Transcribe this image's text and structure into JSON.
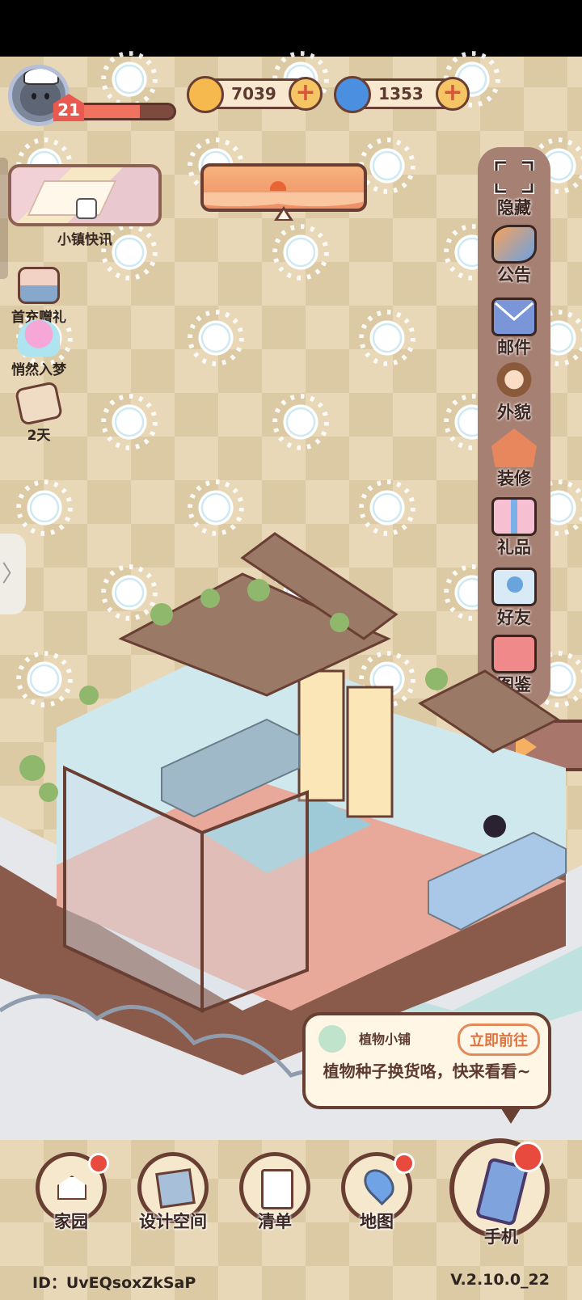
{
  "player": {
    "level": "21",
    "level_progress_pct": 65
  },
  "currencies": [
    {
      "name": "coin-currency",
      "value": "7039",
      "icon": "coin-icon",
      "color": "#f5b94e"
    },
    {
      "name": "gem-currency",
      "value": "1353",
      "icon": "swirl-gem-icon",
      "color": "#4a8fe0"
    }
  ],
  "news": {
    "label": "小镇快讯"
  },
  "left_events": [
    {
      "name": "first-recharge-gift",
      "label": "首充赠礼",
      "icon": "gift-box-icon"
    },
    {
      "name": "dream-event",
      "label": "悄然入梦",
      "icon": "pink-cat-icon"
    },
    {
      "name": "letter-event",
      "label": "2天",
      "icon": "letter-icon"
    }
  ],
  "right_menu": [
    {
      "name": "hide",
      "label": "隐藏",
      "icon": "fullscreen-icon"
    },
    {
      "name": "announcement",
      "label": "公告",
      "icon": "megaphone-icon"
    },
    {
      "name": "mail",
      "label": "邮件",
      "icon": "envelope-icon"
    },
    {
      "name": "appearance",
      "label": "外貌",
      "icon": "character-icon"
    },
    {
      "name": "decorate",
      "label": "装修",
      "icon": "house-wrench-icon"
    },
    {
      "name": "gifts",
      "label": "礼品",
      "icon": "present-icon"
    },
    {
      "name": "friends",
      "label": "好友",
      "icon": "friend-card-icon"
    },
    {
      "name": "collection",
      "label": "图鉴",
      "icon": "album-icon"
    }
  ],
  "notification": {
    "title": "植物小铺",
    "button": "立即前往",
    "message": "植物种子换货咯，快来看看~"
  },
  "bottom_nav": [
    {
      "name": "home",
      "label": "家园",
      "icon": "house-icon",
      "badge": true
    },
    {
      "name": "design",
      "label": "设计空间",
      "icon": "ruler-icon",
      "badge": false
    },
    {
      "name": "list",
      "label": "清单",
      "icon": "checklist-icon",
      "badge": false
    },
    {
      "name": "map",
      "label": "地图",
      "icon": "map-pin-icon",
      "badge": true
    },
    {
      "name": "phone",
      "label": "手机",
      "icon": "phone-icon",
      "badge": true
    }
  ],
  "footer": {
    "id": "ID：UvEQsoxZkSaP",
    "version": "V.2.10.0_22"
  },
  "colors": {
    "accent_brown": "#6a3f33",
    "badge_red": "#e84a3d",
    "menu_panel": "#a68072"
  }
}
